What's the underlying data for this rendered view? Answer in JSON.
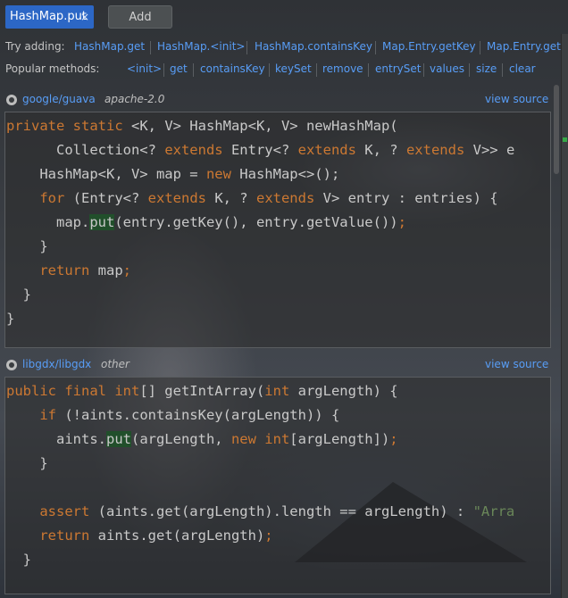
{
  "tab": {
    "title": "HashMap.put",
    "close": "×"
  },
  "add_button": "Add",
  "try_adding": {
    "label": "Try adding:",
    "links": [
      "HashMap.get",
      "HashMap.<init>",
      "HashMap.containsKey",
      "Map.Entry.getKey",
      "Map.Entry.get"
    ]
  },
  "popular": {
    "label": "Popular methods:",
    "links": [
      "<init>",
      "get",
      "containsKey",
      "keySet",
      "remove",
      "entrySet",
      "values",
      "size",
      "clear"
    ]
  },
  "snippets": [
    {
      "repo": "google/guava",
      "license": "apache-2.0",
      "view_source": "view source",
      "lines": [
        "private static <K, V> HashMap<K, V> newHashMap(",
        "      Collection<? extends Entry<? extends K, ? extends V>> e",
        "    HashMap<K, V> map = new HashMap<>();",
        "    for (Entry<? extends K, ? extends V> entry : entries) {",
        "      map.put(entry.getKey(), entry.getValue());",
        "    }",
        "    return map;",
        "  }",
        "}"
      ]
    },
    {
      "repo": "libgdx/libgdx",
      "license": "other",
      "view_source": "view source",
      "lines": [
        "public final int[] getIntArray(int argLength) {",
        "    if (!aints.containsKey(argLength)) {",
        "      aints.put(argLength, new int[argLength]);",
        "    }",
        "",
        "    assert (aints.get(argLength).length == argLength) : \"Arra",
        "    return aints.get(argLength);",
        "  }"
      ]
    }
  ],
  "colors": {
    "accent": "#2c67c6",
    "link": "#589df6",
    "keyword": "#cc7832",
    "highlight": "#214f2b"
  },
  "icons": {
    "repo": "github-icon"
  }
}
